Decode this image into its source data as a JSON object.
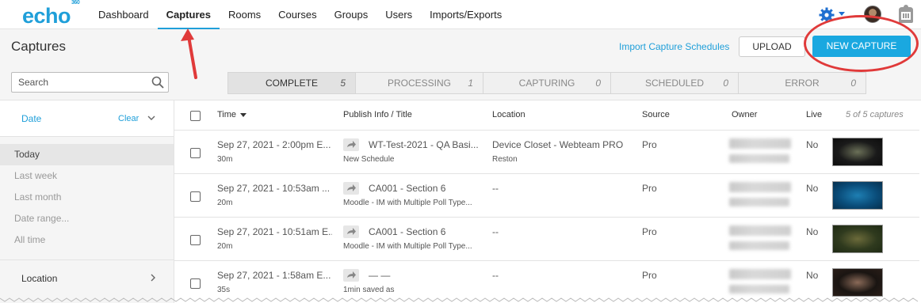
{
  "app": {
    "logo": "echo",
    "logo_sup": "360"
  },
  "nav": {
    "items": [
      "Dashboard",
      "Captures",
      "Rooms",
      "Courses",
      "Groups",
      "Users",
      "Imports/Exports"
    ],
    "active": "Captures"
  },
  "header": {
    "title": "Captures",
    "import_link": "Import Capture Schedules",
    "upload_label": "UPLOAD",
    "new_capture_label": "NEW CAPTURE"
  },
  "search": {
    "placeholder": "Search"
  },
  "tabs": [
    {
      "label": "COMPLETE",
      "count": "5"
    },
    {
      "label": "PROCESSING",
      "count": "1"
    },
    {
      "label": "CAPTURING",
      "count": "0"
    },
    {
      "label": "SCHEDULED",
      "count": "0"
    },
    {
      "label": "ERROR",
      "count": "0"
    }
  ],
  "filters": {
    "date": {
      "label": "Date",
      "clear": "Clear",
      "options": [
        "Today",
        "Last week",
        "Last month",
        "Date range...",
        "All time"
      ],
      "selected": "Today"
    },
    "location": {
      "label": "Location"
    }
  },
  "table": {
    "columns": [
      "Time",
      "Publish Info / Title",
      "Location",
      "Source",
      "Owner",
      "Live"
    ],
    "count_label": "5 of 5 captures",
    "rows": [
      {
        "time": "Sep 27, 2021 - 2:00pm E...",
        "duration": "30m",
        "title": "WT-Test-2021 - QA Basi...",
        "subtitle": "New Schedule",
        "location": "Device Closet - Webteam PRO",
        "location_sub": "Reston",
        "source": "Pro",
        "live": "No",
        "thumb_colors": [
          "#1a1a1a",
          "#6b7058",
          "#0d0d0d"
        ]
      },
      {
        "time": "Sep 27, 2021 - 10:53am ...",
        "duration": "20m",
        "title": "CA001 - Section 6",
        "subtitle": "Moodle - IM with Multiple Poll Type...",
        "location": "--",
        "location_sub": "",
        "source": "Pro",
        "live": "No",
        "thumb_colors": [
          "#0a4d7a",
          "#1e7fb3",
          "#06304f"
        ]
      },
      {
        "time": "Sep 27, 2021 - 10:51am E...",
        "duration": "20m",
        "title": "CA001 - Section 6",
        "subtitle": "Moodle - IM with Multiple Poll Type...",
        "location": "--",
        "location_sub": "",
        "source": "Pro",
        "live": "No",
        "thumb_colors": [
          "#2f3a1e",
          "#6b6a3a",
          "#1f2a14"
        ]
      },
      {
        "time": "Sep 27, 2021 - 1:58am E...",
        "duration": "35s",
        "title": "— —",
        "subtitle": "1min saved as",
        "location": "--",
        "location_sub": "",
        "source": "Pro",
        "live": "No",
        "thumb_colors": [
          "#1a1512",
          "#8a6a58",
          "#2a1e18"
        ]
      }
    ]
  }
}
